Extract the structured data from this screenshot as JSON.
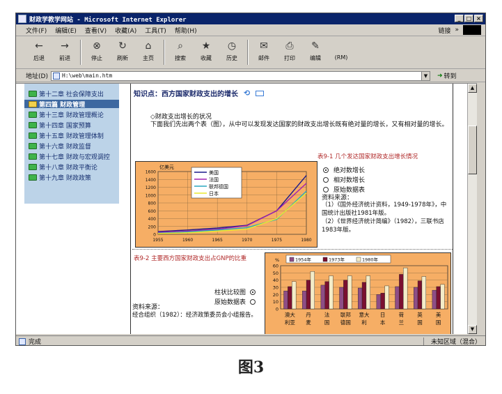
{
  "window": {
    "title": "财政学教学网站 - Microsoft Internet Explorer",
    "buttons": [
      "_",
      "□",
      "×"
    ]
  },
  "menubar": {
    "items": [
      "文件(F)",
      "编辑(E)",
      "查看(V)",
      "收藏(A)",
      "工具(T)",
      "帮助(H)"
    ],
    "links_label": "链接",
    "links_chevron": "»"
  },
  "toolbar": {
    "buttons": [
      {
        "label": "后退",
        "icon": "back-arrow-icon",
        "glyph": "←"
      },
      {
        "label": "前进",
        "icon": "forward-arrow-icon",
        "glyph": "→"
      },
      {
        "label": "停止",
        "icon": "stop-icon",
        "glyph": "⊗"
      },
      {
        "label": "刷新",
        "icon": "refresh-icon",
        "glyph": "↻"
      },
      {
        "label": "主页",
        "icon": "home-icon",
        "glyph": "⌂"
      },
      {
        "label": "搜索",
        "icon": "search-icon",
        "glyph": "⌕"
      },
      {
        "label": "收藏",
        "icon": "favorites-icon",
        "glyph": "★"
      },
      {
        "label": "历史",
        "icon": "history-icon",
        "glyph": "◷"
      },
      {
        "label": "邮件",
        "icon": "mail-icon",
        "glyph": "✉"
      },
      {
        "label": "打印",
        "icon": "print-icon",
        "glyph": "⎙"
      },
      {
        "label": "编辑",
        "icon": "edit-icon",
        "glyph": "✎"
      },
      {
        "label": "(RM)",
        "icon": "media-icon",
        "glyph": ""
      }
    ]
  },
  "address": {
    "label": "地址(D)",
    "url": "H:\\web\\main.htm",
    "go_label": "转到"
  },
  "sidebar": {
    "items": [
      {
        "label": "第十二章  社会保障支出",
        "active": false
      },
      {
        "label": "第四篇  财政管理",
        "active": true
      },
      {
        "label": "第十三章  财政管理概论",
        "active": false
      },
      {
        "label": "第十四章  国家预算",
        "active": false
      },
      {
        "label": "第十五章  财政管理体制",
        "active": false
      },
      {
        "label": "第十六章  财政监督",
        "active": false
      },
      {
        "label": "第十七章  财政与宏观调控",
        "active": false
      },
      {
        "label": "第十八章  财政平衡论",
        "active": false
      },
      {
        "label": "第十九章  财政政策",
        "active": false
      }
    ]
  },
  "content": {
    "heading": "知识点：西方国家财政支出的增长",
    "subheading": "◇财政支出增长的状况",
    "paragraph": "下面我们先出两个表（图），从中可以发现发达国家的财政支出增长既有绝对量的增长，又有相对量的增长。",
    "table1_caption": "表9-1  几个发达国家财政支出增长情况",
    "radios1": [
      {
        "label": "绝对数增长",
        "checked": true
      },
      {
        "label": "相对数增长",
        "checked": false
      },
      {
        "label": "原始数据表",
        "checked": false
      }
    ],
    "source1_title": "资料来源：",
    "source1_lines": [
      "（1）《国外经济统计资料，1949-1978年》，中国统计出版社1981年版。",
      "（2）《世界经济统计简编》（1982），三联书店1983年版。"
    ],
    "table2_caption": "表9-2  主要西方国家财政支出占GNP的比重",
    "radios2": [
      {
        "label": "柱状比较图",
        "checked": true
      },
      {
        "label": "原始数据表",
        "checked": false
      }
    ],
    "source2_title": "资料来源：",
    "source2_text": "经合组织（1982）：经济政策委员会小组报告。"
  },
  "status": {
    "text": "完成",
    "zone": "未知区域（混合）"
  },
  "figure_caption": "图3",
  "chart_data": [
    {
      "type": "line",
      "title": "",
      "ylabel": "亿美元",
      "x": [
        1955,
        1960,
        1965,
        1970,
        1975,
        1980
      ],
      "ylim": [
        0,
        1600
      ],
      "yticks": [
        0,
        200,
        400,
        600,
        800,
        1000,
        1200,
        1400,
        1600
      ],
      "grid": true,
      "legend": "top-left",
      "series": [
        {
          "name": "美国",
          "color": "#1a1a8c",
          "values": [
            70,
            110,
            160,
            230,
            600,
            1500
          ]
        },
        {
          "name": "法国",
          "color": "#a020b0",
          "values": [
            50,
            80,
            130,
            220,
            600,
            1300
          ]
        },
        {
          "name": "联邦德国",
          "color": "#2aa7c0",
          "values": [
            30,
            60,
            110,
            170,
            380,
            1100
          ]
        },
        {
          "name": "日本",
          "color": "#e8e830",
          "values": [
            20,
            40,
            80,
            130,
            400,
            1050
          ]
        }
      ]
    },
    {
      "type": "bar",
      "title": "",
      "ylabel": "%",
      "ylim": [
        0,
        60
      ],
      "yticks": [
        0,
        10,
        20,
        30,
        40,
        50,
        60
      ],
      "grid": true,
      "legend": "top",
      "categories": [
        "澳大利亚",
        "丹麦",
        "法国",
        "联邦德国",
        "意大利",
        "日本",
        "荷兰",
        "英国",
        "美国"
      ],
      "category_lines": [
        [
          "澳大",
          "利亚"
        ],
        [
          "丹",
          "麦"
        ],
        [
          "法",
          "国"
        ],
        [
          "联邦",
          "德国"
        ],
        [
          "意大",
          "利"
        ],
        [
          "日",
          "本"
        ],
        [
          "荷",
          "兰"
        ],
        [
          "英",
          "国"
        ],
        [
          "美",
          "国"
        ]
      ],
      "series": [
        {
          "name": "1954年",
          "color": "#8e4d86",
          "values": [
            25,
            25,
            33,
            30,
            29,
            20,
            31,
            30,
            26
          ]
        },
        {
          "name": "1973年",
          "color": "#7a1030",
          "values": [
            31,
            40,
            38,
            40,
            37,
            22,
            48,
            39,
            31
          ]
        },
        {
          "name": "1980年",
          "color": "#f4ecc8",
          "values": [
            38,
            52,
            46,
            46,
            46,
            32,
            57,
            45,
            34
          ]
        }
      ]
    }
  ]
}
